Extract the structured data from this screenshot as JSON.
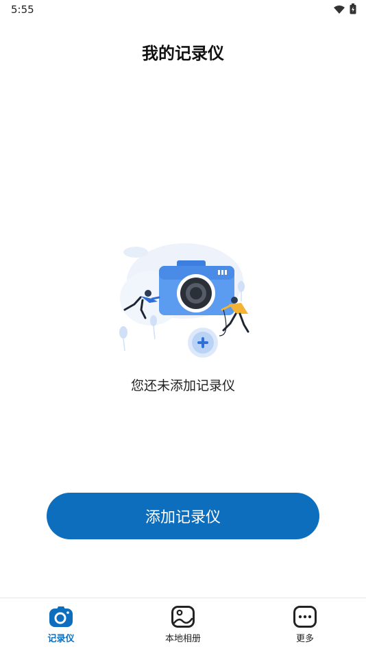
{
  "status_bar": {
    "time": "5:55"
  },
  "header": {
    "title": "我的记录仪"
  },
  "empty_state": {
    "message": "您还未添加记录仪",
    "illustration": "camera-add-illustration"
  },
  "actions": {
    "add_label": "添加记录仪"
  },
  "bottom_nav": {
    "items": [
      {
        "label": "记录仪",
        "icon": "camera-icon",
        "active": true
      },
      {
        "label": "本地相册",
        "icon": "album-icon",
        "active": false
      },
      {
        "label": "更多",
        "icon": "more-icon",
        "active": false
      }
    ]
  },
  "colors": {
    "accent": "#0d6ebd",
    "text": "#1f1f1f",
    "background": "#ffffff"
  }
}
